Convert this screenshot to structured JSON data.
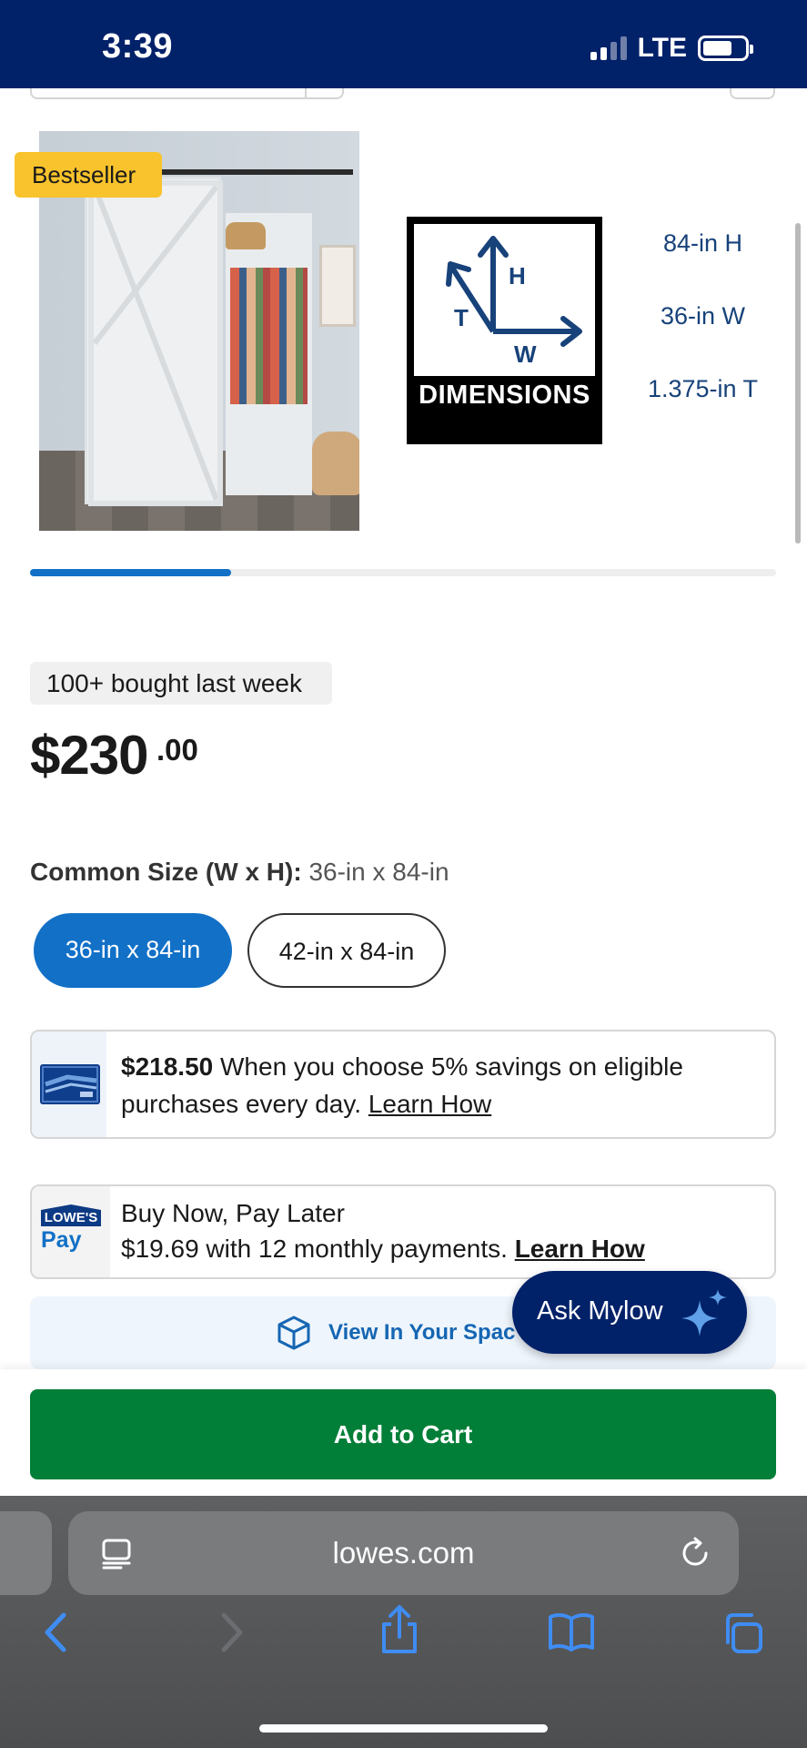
{
  "status_bar": {
    "time": "3:39",
    "network": "LTE",
    "signal_bars_active": 2,
    "signal_bars_total": 4,
    "battery_level": 0.7
  },
  "product": {
    "badge": "Bestseller",
    "dimensions_label": "DIMENSIONS",
    "diagram_letters": {
      "height": "H",
      "thickness": "T",
      "width": "W"
    },
    "dimension_specs": [
      "84-in H",
      "36-in W",
      "1.375-in T"
    ],
    "gallery_progress": 0.27,
    "bought": "100+ bought last week",
    "price": {
      "dollars": "$230",
      "cents": ".00"
    },
    "size_label": "Common Size (W x H):",
    "size_value": "36-in x 84-in",
    "size_options": [
      {
        "label": "36-in x 84-in",
        "selected": true
      },
      {
        "label": "42-in x 84-in",
        "selected": false
      }
    ]
  },
  "savings_card": {
    "amount": "$218.50",
    "text": " When you choose 5% savings on eligible purchases every day. ",
    "link": "Learn How"
  },
  "bnpl_card": {
    "logo_top": "LOWE'S",
    "logo_bottom": "Pay",
    "line1": "Buy Now, Pay Later",
    "line2": "$19.69 with 12 monthly payments. ",
    "link": "Learn How"
  },
  "view_in_space": {
    "label": "View In Your Spac"
  },
  "ask_mylow": {
    "label": "Ask Mylow"
  },
  "add_to_cart": {
    "label": "Add to Cart"
  },
  "browser": {
    "url": "lowes.com",
    "nav_icons": [
      "back-icon",
      "forward-icon",
      "share-icon",
      "bookmarks-icon",
      "tabs-icon"
    ]
  },
  "colors": {
    "brand_navy": "#012169",
    "accent_blue": "#1270c7",
    "cart_green": "#017e37",
    "badge_yellow": "#f8c32c"
  }
}
